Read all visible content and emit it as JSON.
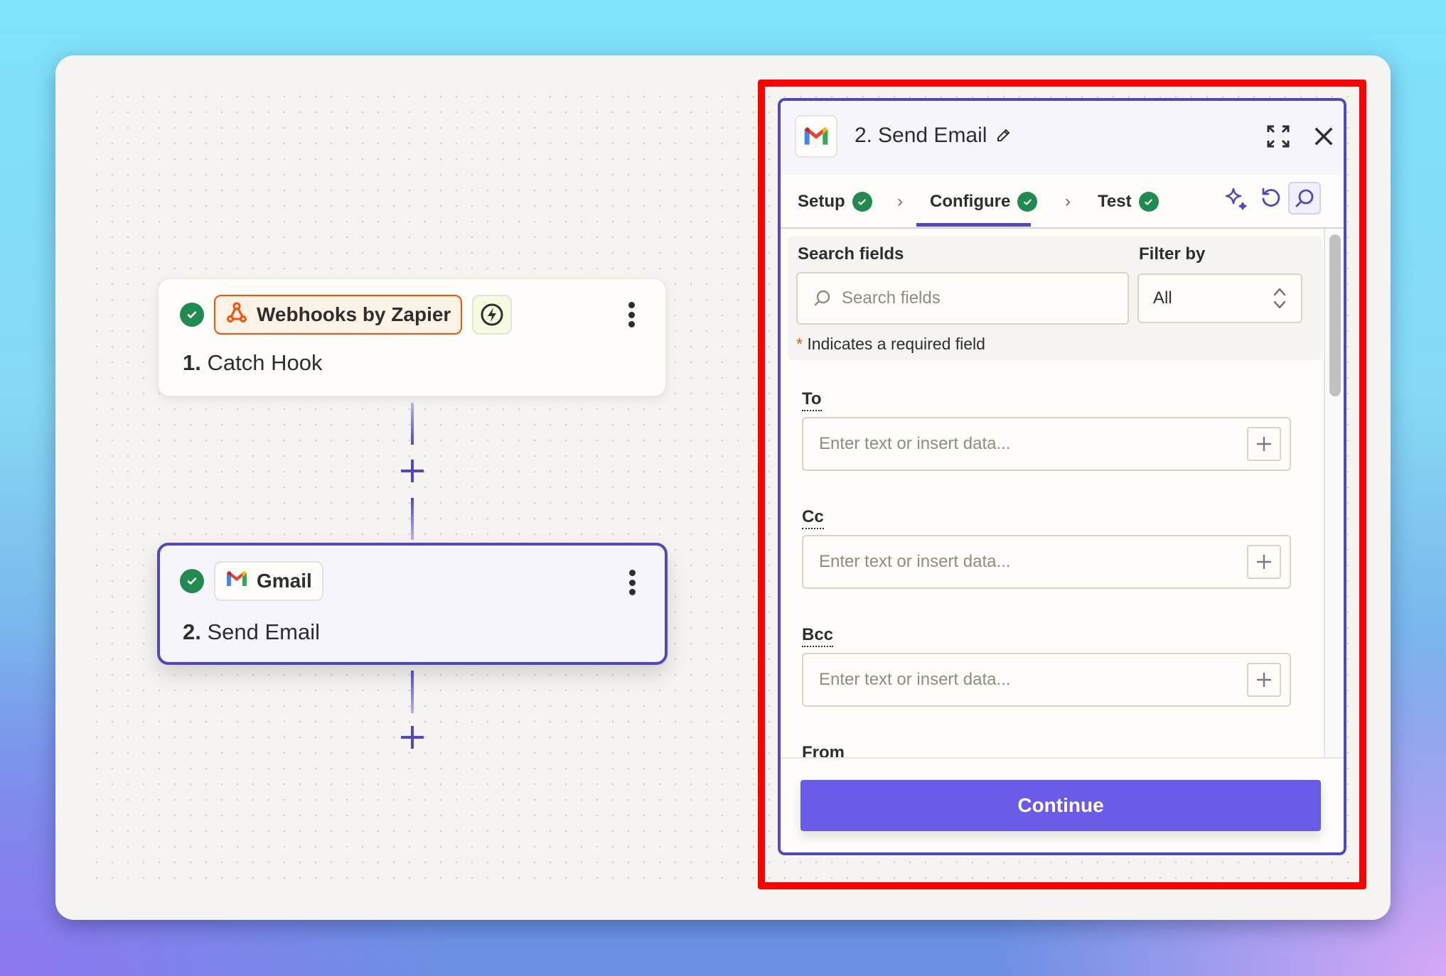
{
  "colors": {
    "accent": "#5246c1",
    "primary_button": "#695be8",
    "success": "#218a4f",
    "webhooks_brand": "#ff4f00",
    "highlight": "#ff0000"
  },
  "canvas": {
    "steps": [
      {
        "number": "1.",
        "title": "Catch Hook",
        "app": "Webhooks by Zapier",
        "app_icon": "webhook-icon",
        "trigger_icon": "lightning-bolt-icon",
        "status": "complete",
        "selected": false
      },
      {
        "number": "2.",
        "title": "Send Email",
        "app": "Gmail",
        "app_icon": "gmail-icon",
        "status": "complete",
        "selected": true
      }
    ],
    "add_step_label": "+"
  },
  "panel": {
    "step_number": "2.",
    "title": "Send Email",
    "app_icon": "gmail-icon",
    "tabs": [
      {
        "label": "Setup",
        "status": "complete",
        "active": false
      },
      {
        "label": "Configure",
        "status": "complete",
        "active": true
      },
      {
        "label": "Test",
        "status": "complete",
        "active": false
      }
    ],
    "toolbar_icons": [
      "sparkle-icon",
      "refresh-icon",
      "search-icon"
    ],
    "search": {
      "label": "Search fields",
      "placeholder": "Search fields",
      "value": ""
    },
    "filter": {
      "label": "Filter by",
      "value": "All"
    },
    "required_note": "Indicates a required field",
    "required_marker": "*",
    "fields": [
      {
        "label": "To",
        "placeholder": "Enter text or insert data...",
        "value": ""
      },
      {
        "label": "Cc",
        "placeholder": "Enter text or insert data...",
        "value": ""
      },
      {
        "label": "Bcc",
        "placeholder": "Enter text or insert data...",
        "value": ""
      },
      {
        "label": "From",
        "placeholder": "",
        "value": ""
      }
    ],
    "continue_label": "Continue"
  }
}
